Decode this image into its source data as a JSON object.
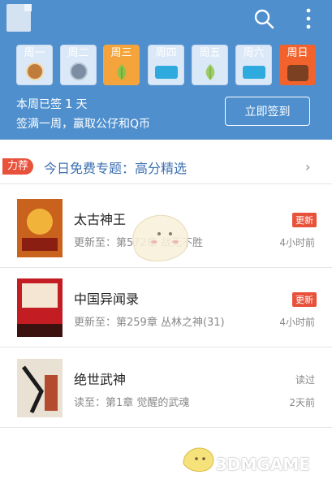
{
  "header": {
    "days": [
      {
        "label": "周一",
        "state": "done",
        "icon": "signed-badge-icon"
      },
      {
        "label": "周二",
        "state": "missed",
        "icon": "missed-badge-icon"
      },
      {
        "label": "周三",
        "state": "today",
        "icon": "leaf-icon"
      },
      {
        "label": "周四",
        "state": "future",
        "icon": "ticket-icon"
      },
      {
        "label": "周五",
        "state": "future",
        "icon": "leaf-icon"
      },
      {
        "label": "周六",
        "state": "future",
        "icon": "ticket-icon"
      },
      {
        "label": "周日",
        "state": "future",
        "icon": "gift-box-icon"
      }
    ],
    "summary_prefix": "本周已签",
    "summary_count": "1",
    "summary_suffix": "天",
    "summary_line2": "签满一周，赢取公仔和Q币",
    "signin_button": "立即签到"
  },
  "recommend": {
    "tag": "力荐",
    "title": "今日免费专题：高分精选"
  },
  "books": [
    {
      "title": "太古神王",
      "sub": "更新至：第572章 战无不胜",
      "status": "更新",
      "time": "4小时前",
      "cover_text": "太古神王"
    },
    {
      "title": "中国异闻录",
      "sub": "更新至：第259章 丛林之神(31)",
      "status": "更新",
      "time": "4小时前",
      "cover_text": "中国异闻录"
    },
    {
      "title": "绝世武神",
      "sub": "读至：第1章 觉醒的武魂",
      "status": "读过",
      "time": "2天前",
      "cover_text": "绝世武神"
    }
  ],
  "watermark": "3DMGAME",
  "colors": {
    "header_bg": "#4f8fcd",
    "accent_red": "#e8513a",
    "today": "#f4a43a"
  }
}
